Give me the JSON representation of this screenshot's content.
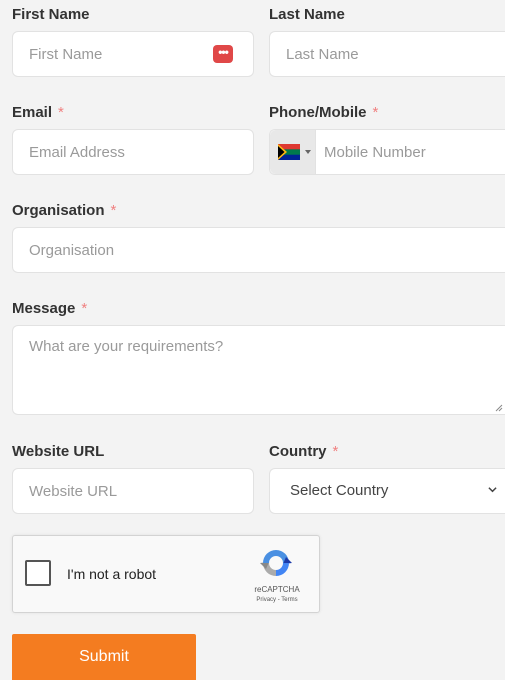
{
  "fields": {
    "first_name": {
      "label": "First Name",
      "placeholder": "First Name",
      "required": false
    },
    "last_name": {
      "label": "Last Name",
      "placeholder": "Last Name",
      "required": false
    },
    "email": {
      "label": "Email",
      "placeholder": "Email Address",
      "required": true
    },
    "phone": {
      "label": "Phone/Mobile",
      "placeholder": "Mobile Number",
      "required": true,
      "flag": "south-africa-flag-icon"
    },
    "organisation": {
      "label": "Organisation",
      "placeholder": "Organisation",
      "required": true
    },
    "message": {
      "label": "Message",
      "placeholder": "What are your requirements?",
      "required": true
    },
    "website": {
      "label": "Website URL",
      "placeholder": "Website URL",
      "required": false
    },
    "country": {
      "label": "Country",
      "selected": "Select Country",
      "required": true
    }
  },
  "required_marker": "*",
  "password_manager_icon": "•••",
  "recaptcha": {
    "label": "I'm not a robot",
    "brand": "reCAPTCHA",
    "terms": "Privacy - Terms"
  },
  "submit_label": "Submit",
  "colors": {
    "background": "#f3f3f3",
    "required": "#f08080",
    "submit": "#f47c20",
    "password_icon": "#e04848"
  }
}
